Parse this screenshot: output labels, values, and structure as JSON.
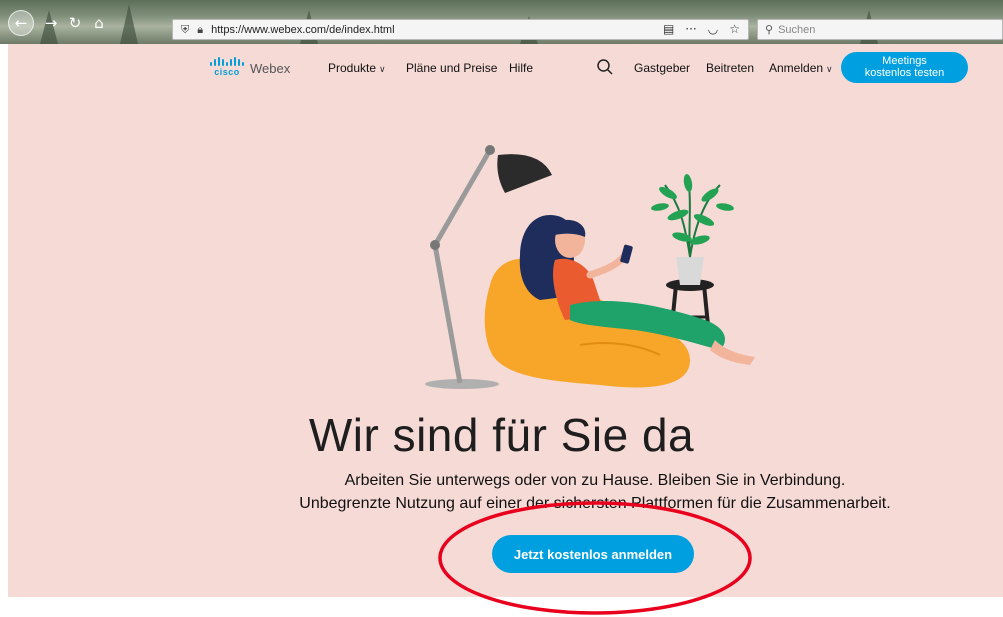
{
  "browser": {
    "url": "https://www.webex.com/de/index.html",
    "search_placeholder": "Suchen",
    "icons": [
      "back-icon",
      "forward-icon",
      "reload-icon",
      "home-icon",
      "shield-icon",
      "lock-icon",
      "reader-icon",
      "more-icon",
      "pocket-icon",
      "star-icon",
      "search-icon"
    ]
  },
  "header": {
    "logo_cisco": "cisco",
    "logo_webex": "Webex",
    "nav": {
      "produkte": "Produkte",
      "plaene": "Pläne und Preise",
      "hilfe": "Hilfe",
      "gastgeber": "Gastgeber",
      "beitreten": "Beitreten",
      "anmelden": "Anmelden"
    },
    "cta_line1": "Meetings",
    "cta_line2": "kostenlos testen"
  },
  "hero": {
    "title": "Wir sind für Sie da",
    "line1": "Arbeiten Sie unterwegs oder von zu Hause. Bleiben Sie in Verbindung.",
    "line2": "Unbegrenzte Nutzung auf einer der sichersten Plattformen für die Zusammenarbeit.",
    "cta": "Jetzt kostenlos anmelden"
  },
  "colors": {
    "page_bg": "#f6dad6",
    "accent": "#00a0e0",
    "annotation": "#e8001c"
  }
}
